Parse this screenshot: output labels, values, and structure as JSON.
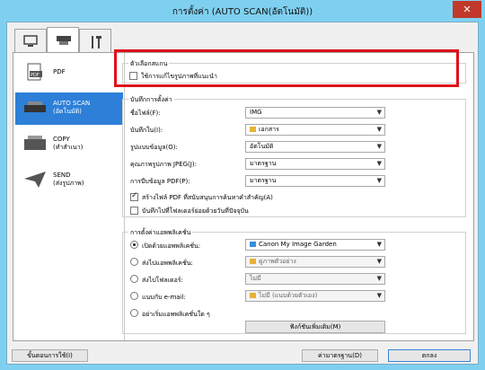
{
  "window": {
    "title": "การตั้งค่า (AUTO SCAN(อัตโนมัติ))",
    "close_glyph": "✕"
  },
  "tabs": [
    {
      "name": "scan-from-computer",
      "icon": "computer-scan-icon"
    },
    {
      "name": "scan-from-operation-panel",
      "icon": "scanner-icon"
    },
    {
      "name": "general-settings",
      "icon": "tools-icon"
    }
  ],
  "sidebar": {
    "items": [
      {
        "label": "PDF",
        "icon": "pdf-icon"
      },
      {
        "label": "AUTO SCAN\n(อัตโนมัติ)",
        "icon": "auto-scan-icon",
        "active": true
      },
      {
        "label": "COPY\n(ทำสำเนา)",
        "icon": "copy-icon"
      },
      {
        "label": "SEND\n(ส่งรูปภาพ)",
        "icon": "send-icon"
      }
    ]
  },
  "scan_options": {
    "title": "ตัวเลือกสแกน",
    "recommended_label": "ใช้การแก้ไขรูปภาพที่แนะนำ"
  },
  "save_settings": {
    "title": "บันทึกการตั้งค่า",
    "file_name_label": "ชื่อไฟล์(F):",
    "file_name_value": "IMG",
    "save_in_label": "บันทึกใน(I):",
    "save_in_value": "เอกสาร",
    "data_format_label": "รูปแบบข้อมูล(O):",
    "data_format_value": "อัตโนมัติ",
    "jpeg_quality_label": "คุณภาพรูปภาพ JPEG(J):",
    "jpeg_quality_value": "มาตรฐาน",
    "pdf_compression_label": "การบีบข้อมูล PDF(P):",
    "pdf_compression_value": "มาตรฐาน",
    "searchable_pdf_label": "สร้างไฟล์ PDF ที่สนับสนุนการค้นหาคำสำคัญ(A)",
    "subfolder_label": "บันทึกไปที่โฟลเดอร์ย่อยด้วยวันที่ปัจจุบัน"
  },
  "app_settings": {
    "title": "การตั้งค่าแอพพลิเคชั่น",
    "open_app_label": "เปิดด้วยแอพพลิเคชั่น:",
    "open_app_value": "Canon My Image Garden",
    "send_app_label": "ส่งไปแอพพลิเคชั่น:",
    "send_app_value": "ดูภาพตัวอย่าง",
    "send_folder_label": "ส่งไปโฟลเดอร์:",
    "send_folder_value": "ไม่มี",
    "email_label": "แนบกับ e-mail:",
    "email_value": "ไม่มี (แนบด้วยตัวเอง)",
    "start_app_label": "อย่าเริ่มแอพพลิเคชั่นใด ๆ",
    "more_functions_label": "ฟังก์ชันเพิ่มเติม(M)"
  },
  "footer": {
    "instructions": "ขั้นตอนการใช้(I)",
    "defaults": "ค่ามาตรฐาน(D)",
    "ok": "ตกลง"
  }
}
